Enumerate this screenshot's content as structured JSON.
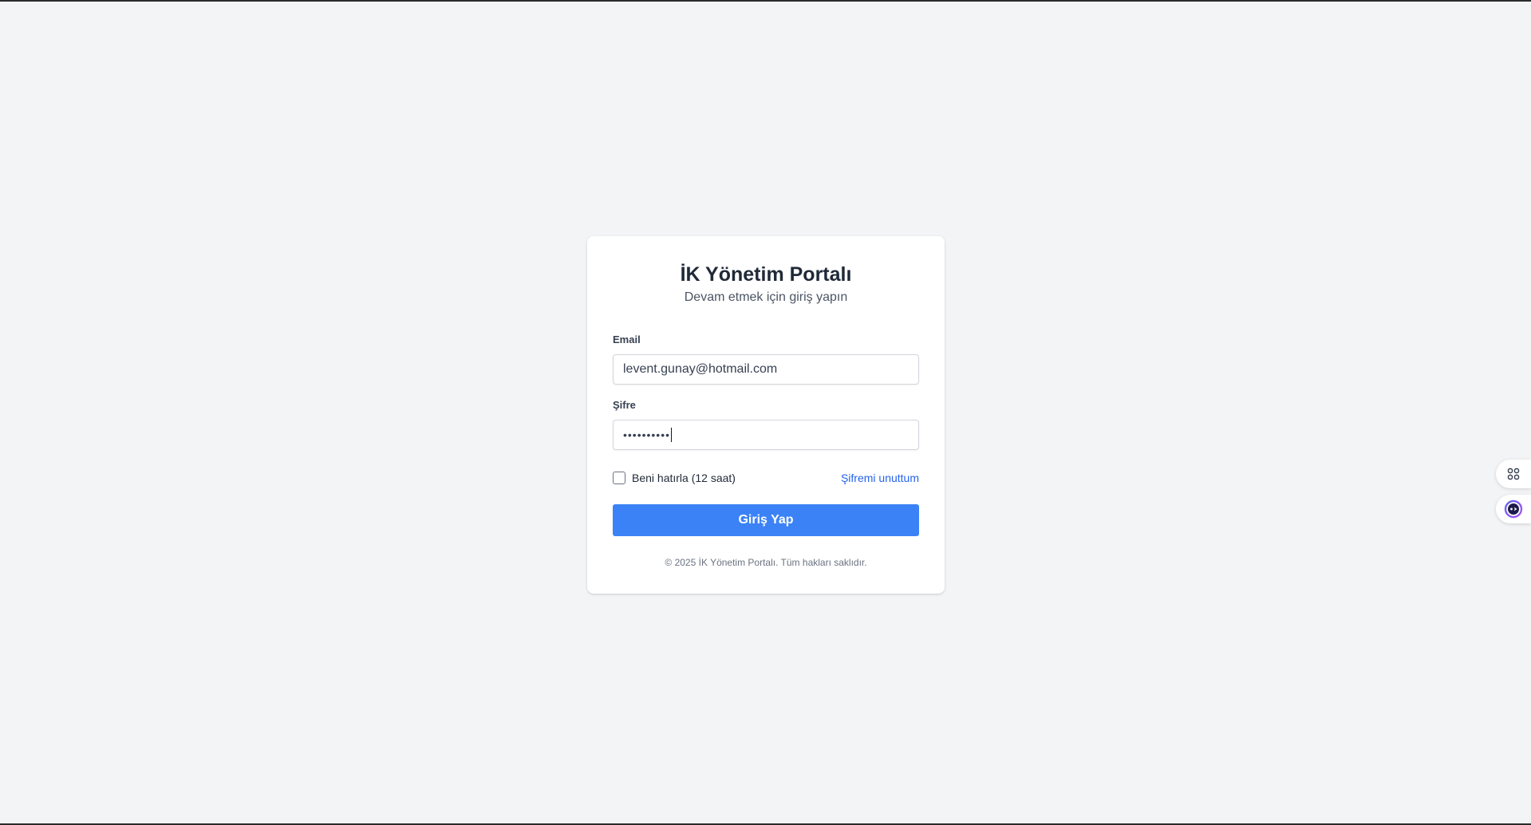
{
  "login": {
    "title": "İK Yönetim Portalı",
    "subtitle": "Devam etmek için giriş yapın",
    "email_label": "Email",
    "email_value": "levent.gunay@hotmail.com",
    "password_label": "Şifre",
    "password_masked": "••••••••••",
    "remember_label": "Beni hatırla (12 saat)",
    "remember_checked": false,
    "forgot_label": "Şifremi unuttum",
    "submit_label": "Giriş Yap",
    "footer": "© 2025 İK Yönetim Portalı. Tüm hakları saklıdır."
  },
  "side_widgets": {
    "apps_icon": "apps-grid-icon",
    "assistant_icon": "assistant-bot-icon"
  },
  "colors": {
    "background": "#f3f4f6",
    "primary": "#3b82f6",
    "link": "#2563eb"
  }
}
